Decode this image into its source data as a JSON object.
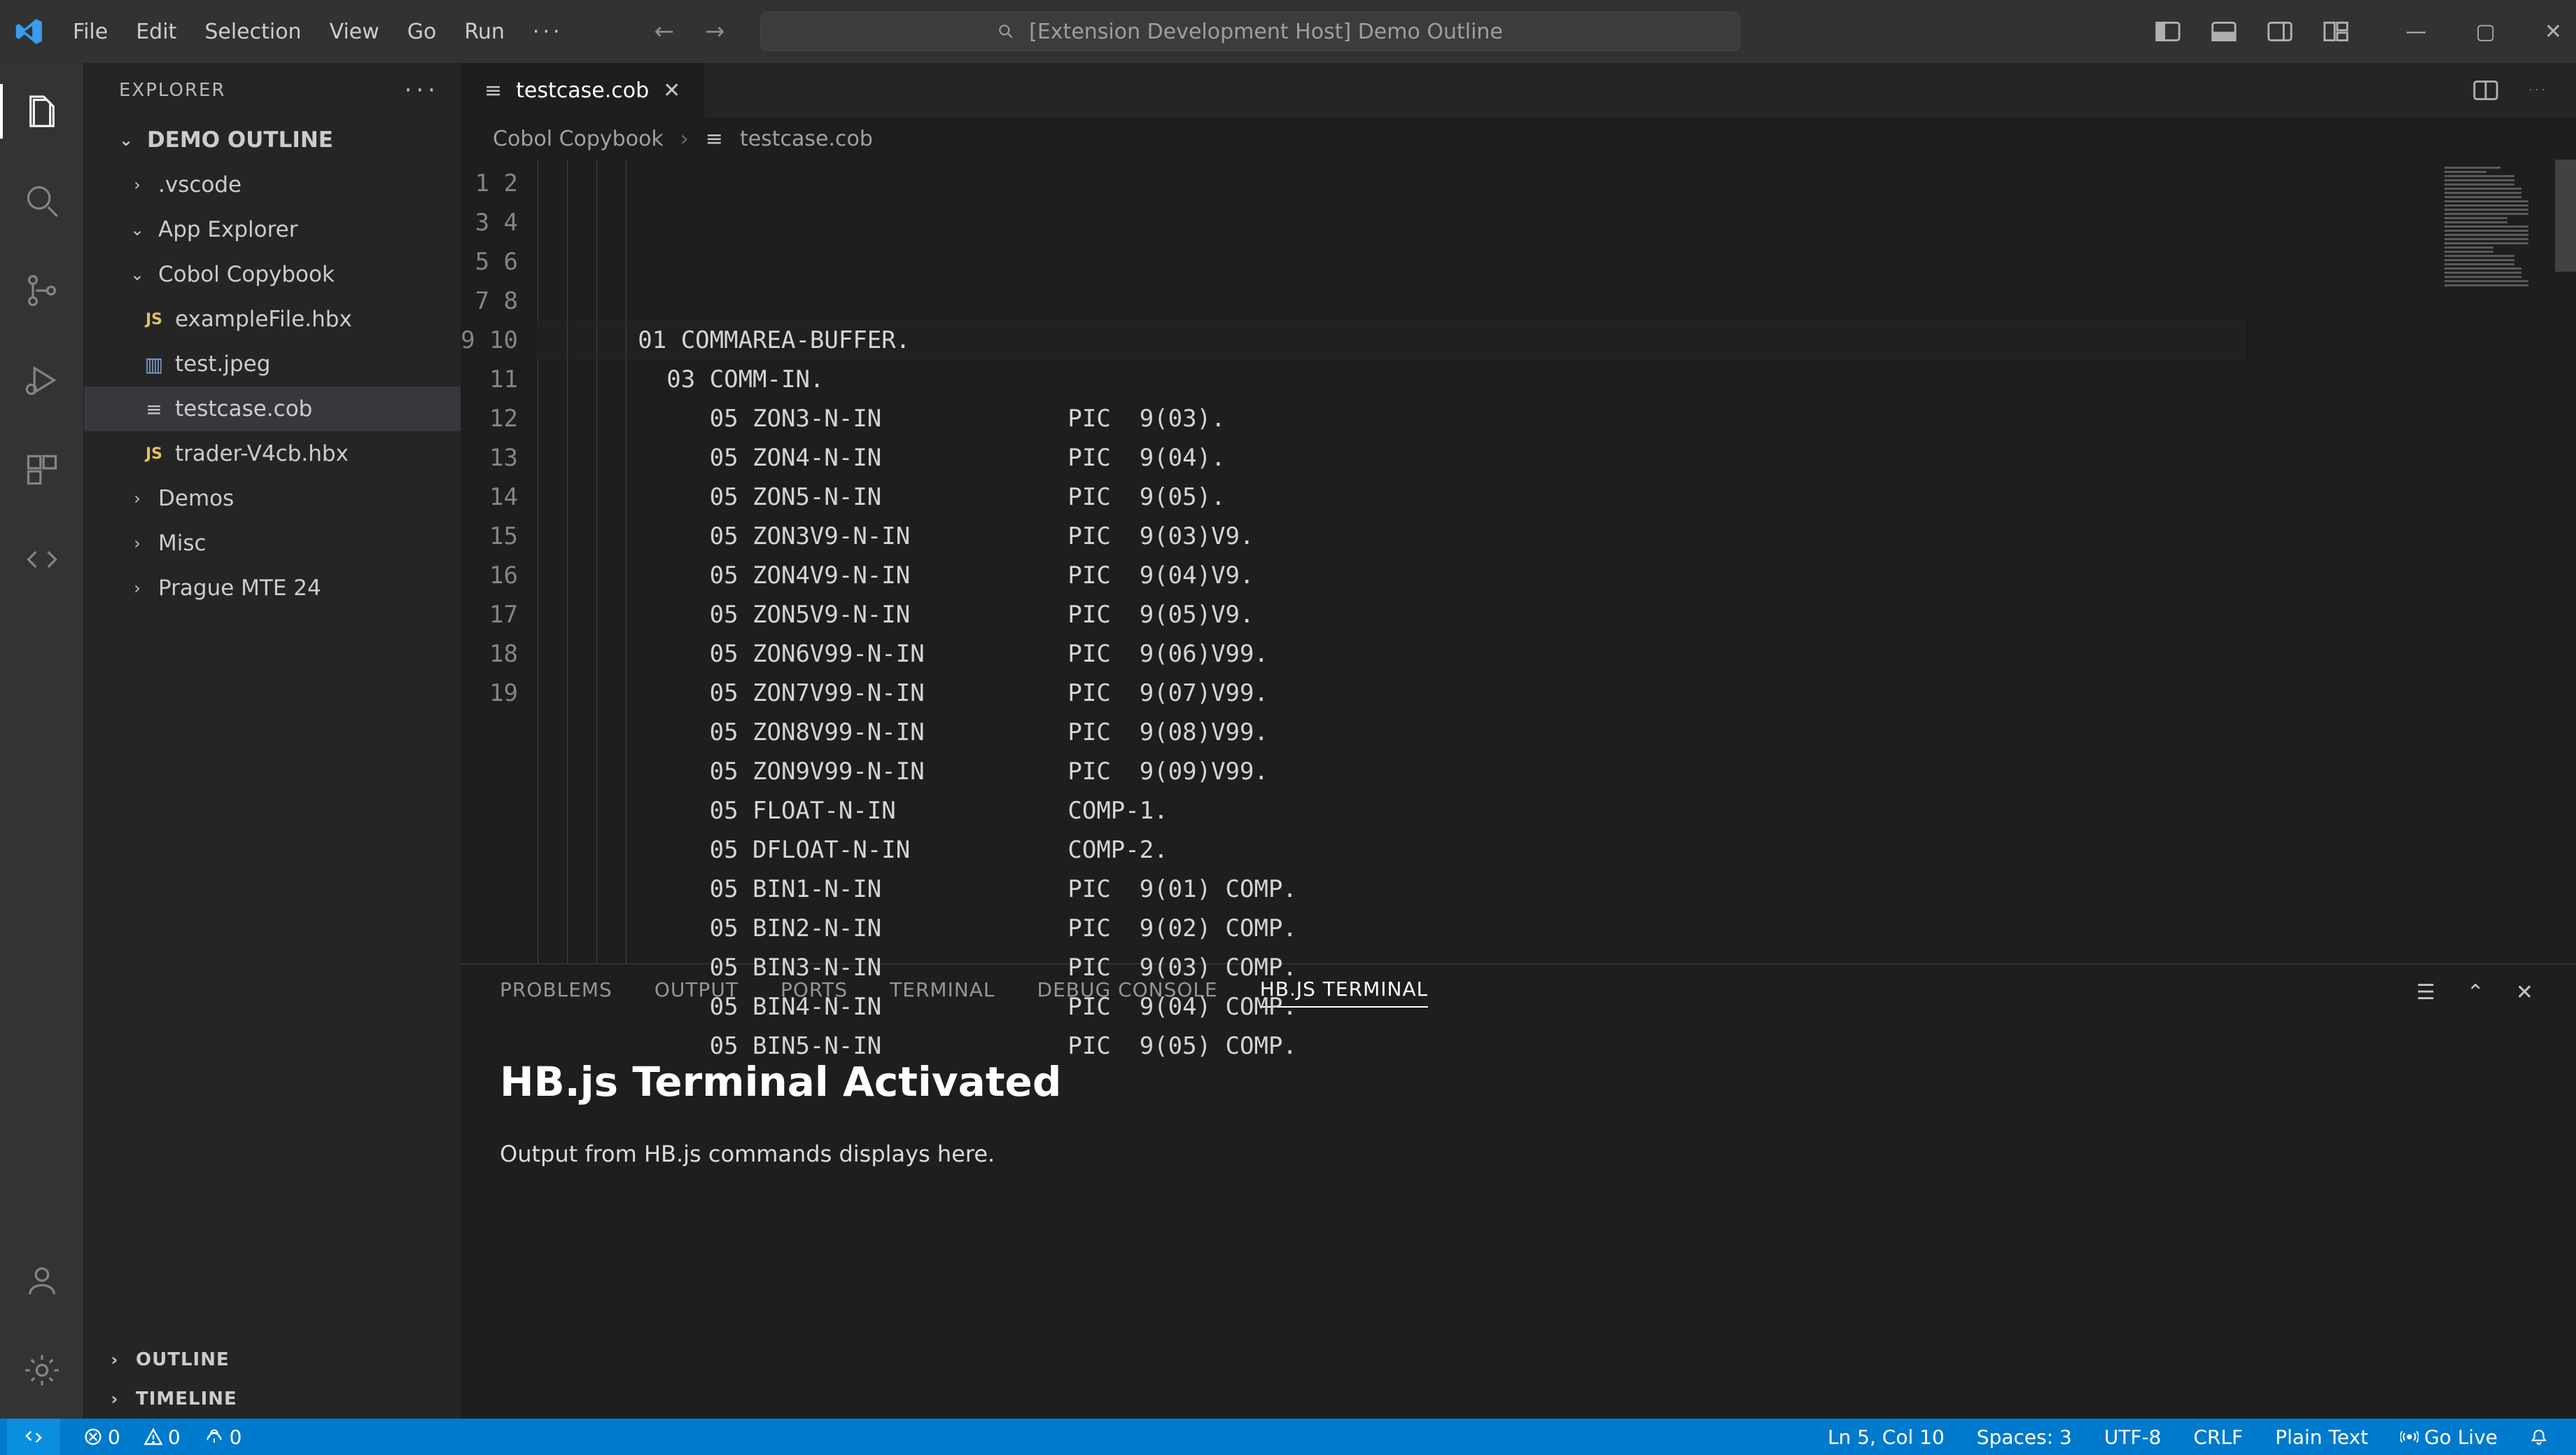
{
  "title": "[Extension Development Host] Demo Outline",
  "menus": [
    "File",
    "Edit",
    "Selection",
    "View",
    "Go",
    "Run"
  ],
  "menu_ellipsis": "···",
  "explorer": {
    "header": "EXPLORER",
    "root": "DEMO OUTLINE"
  },
  "tree": [
    {
      "label": ".vscode",
      "type": "folder",
      "open": false,
      "depth": 1
    },
    {
      "label": "App Explorer",
      "type": "folder",
      "open": true,
      "depth": 1
    },
    {
      "label": "Cobol Copybook",
      "type": "folder",
      "open": true,
      "depth": 1
    },
    {
      "label": "exampleFile.hbx",
      "type": "file",
      "icon": "js",
      "depth": 2
    },
    {
      "label": "test.jpeg",
      "type": "file",
      "icon": "img",
      "depth": 2
    },
    {
      "label": "testcase.cob",
      "type": "file",
      "icon": "cob",
      "depth": 2,
      "selected": true
    },
    {
      "label": "trader-V4cb.hbx",
      "type": "file",
      "icon": "js",
      "depth": 2
    },
    {
      "label": "Demos",
      "type": "folder",
      "open": false,
      "depth": 1
    },
    {
      "label": "Misc",
      "type": "folder",
      "open": false,
      "depth": 1
    },
    {
      "label": "Prague MTE 24",
      "type": "folder",
      "open": false,
      "depth": 1
    }
  ],
  "sidebar_sections": [
    "OUTLINE",
    "TIMELINE"
  ],
  "tab": {
    "icon": "≡",
    "label": "testcase.cob"
  },
  "breadcrumb": {
    "a": "Cobol Copybook",
    "b": "testcase.cob"
  },
  "code_lines": [
    "01 COMMAREA-BUFFER.",
    "  03 COMM-IN.",
    "     05 ZON3-N-IN             PIC  9(03).",
    "     05 ZON4-N-IN             PIC  9(04).",
    "     05 ZON5-N-IN             PIC  9(05).",
    "     05 ZON3V9-N-IN           PIC  9(03)V9.",
    "     05 ZON4V9-N-IN           PIC  9(04)V9.",
    "     05 ZON5V9-N-IN           PIC  9(05)V9.",
    "     05 ZON6V99-N-IN          PIC  9(06)V99.",
    "     05 ZON7V99-N-IN          PIC  9(07)V99.",
    "     05 ZON8V99-N-IN          PIC  9(08)V99.",
    "     05 ZON9V99-N-IN          PIC  9(09)V99.",
    "     05 FLOAT-N-IN            COMP-1.",
    "     05 DFLOAT-N-IN           COMP-2.",
    "     05 BIN1-N-IN             PIC  9(01) COMP.",
    "     05 BIN2-N-IN             PIC  9(02) COMP.",
    "     05 BIN3-N-IN             PIC  9(03) COMP.",
    "     05 BIN4-N-IN             PIC  9(04) COMP.",
    "     05 BIN5-N-IN             PIC  9(05) COMP."
  ],
  "panel_tabs": [
    "PROBLEMS",
    "OUTPUT",
    "PORTS",
    "TERMINAL",
    "DEBUG CONSOLE",
    "HB.JS TERMINAL"
  ],
  "panel_active": 5,
  "panel": {
    "title": "HB.js Terminal Activated",
    "body": "Output from HB.js commands displays here."
  },
  "status": {
    "errors": "0",
    "warnings": "0",
    "ports": "0",
    "ln_col": "Ln 5, Col 10",
    "spaces": "Spaces: 3",
    "enc": "UTF-8",
    "eol": "CRLF",
    "lang": "Plain Text",
    "golive": "Go Live"
  }
}
